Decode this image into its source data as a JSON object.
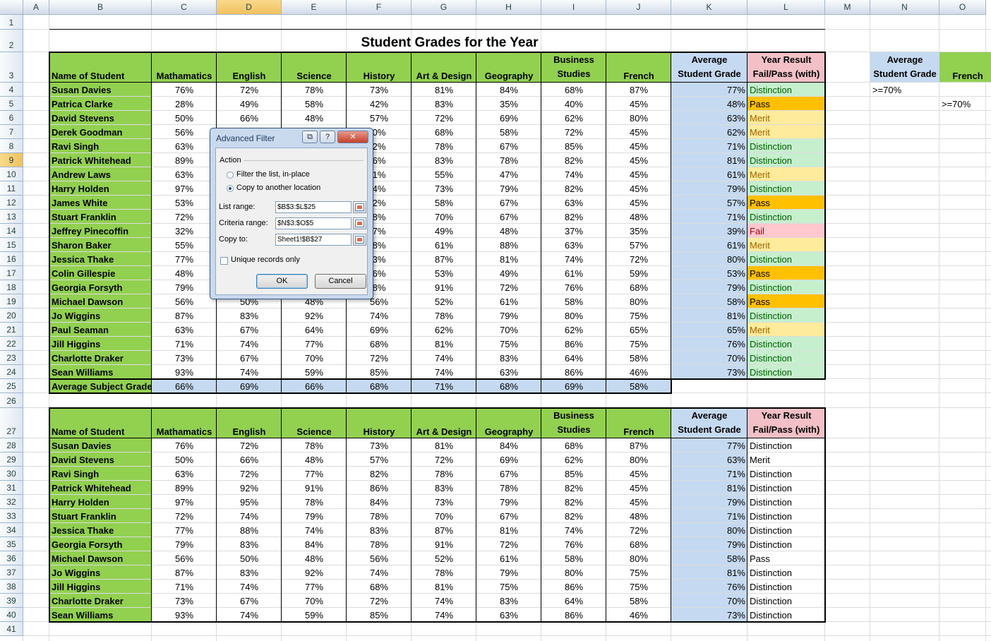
{
  "columns": [
    "A",
    "B",
    "C",
    "D",
    "E",
    "F",
    "G",
    "H",
    "I",
    "J",
    "K",
    "L",
    "M",
    "N",
    "O"
  ],
  "selected_column": "D",
  "selected_row": 9,
  "title": "Student Grades for the Year",
  "header": {
    "name": "Name of Student",
    "subjects": [
      "Mathamatics",
      "English",
      "Science",
      "History",
      "Art & Design",
      "Geography",
      "Business",
      "French"
    ],
    "business_line2": "Studies",
    "avg_line1": "Average",
    "avg_line2": "Student Grade",
    "result_line1": "Year Result",
    "result_line2": "Fail/Pass (with)"
  },
  "main_rows": [
    {
      "name": "Susan Davies",
      "g": [
        "76%",
        "72%",
        "78%",
        "73%",
        "81%",
        "84%",
        "68%",
        "87%"
      ],
      "avg": "77%",
      "result": "Distinction"
    },
    {
      "name": "Patrica Clarke",
      "g": [
        "28%",
        "49%",
        "58%",
        "42%",
        "83%",
        "35%",
        "40%",
        "45%"
      ],
      "avg": "48%",
      "result": "Pass"
    },
    {
      "name": "David Stevens",
      "g": [
        "50%",
        "66%",
        "48%",
        "57%",
        "72%",
        "69%",
        "62%",
        "80%"
      ],
      "avg": "63%",
      "result": "Merit"
    },
    {
      "name": "Derek Goodman",
      "g": [
        "56%",
        "",
        "",
        "0%",
        "68%",
        "58%",
        "72%",
        "45%"
      ],
      "avg": "62%",
      "result": "Merit"
    },
    {
      "name": "Ravi Singh",
      "g": [
        "63%",
        "",
        "",
        "2%",
        "78%",
        "67%",
        "85%",
        "45%"
      ],
      "avg": "71%",
      "result": "Distinction"
    },
    {
      "name": "Patrick Whitehead",
      "g": [
        "89%",
        "",
        "",
        "6%",
        "83%",
        "78%",
        "82%",
        "45%"
      ],
      "avg": "81%",
      "result": "Distinction"
    },
    {
      "name": "Andrew Laws",
      "g": [
        "63%",
        "",
        "",
        "1%",
        "55%",
        "47%",
        "74%",
        "45%"
      ],
      "avg": "61%",
      "result": "Merit"
    },
    {
      "name": "Harry Holden",
      "g": [
        "97%",
        "",
        "",
        "4%",
        "73%",
        "79%",
        "82%",
        "45%"
      ],
      "avg": "79%",
      "result": "Distinction"
    },
    {
      "name": "James White",
      "g": [
        "53%",
        "",
        "",
        "2%",
        "58%",
        "67%",
        "63%",
        "45%"
      ],
      "avg": "57%",
      "result": "Pass"
    },
    {
      "name": "Stuart Franklin",
      "g": [
        "72%",
        "",
        "",
        "8%",
        "70%",
        "67%",
        "82%",
        "48%"
      ],
      "avg": "71%",
      "result": "Distinction"
    },
    {
      "name": "Jeffrey Pinecoffin",
      "g": [
        "32%",
        "",
        "",
        "7%",
        "49%",
        "48%",
        "37%",
        "35%"
      ],
      "avg": "39%",
      "result": "Fail"
    },
    {
      "name": "Sharon Baker",
      "g": [
        "55%",
        "",
        "",
        "8%",
        "61%",
        "88%",
        "63%",
        "57%"
      ],
      "avg": "61%",
      "result": "Merit"
    },
    {
      "name": "Jessica Thake",
      "g": [
        "77%",
        "",
        "",
        "3%",
        "87%",
        "81%",
        "74%",
        "72%"
      ],
      "avg": "80%",
      "result": "Distinction"
    },
    {
      "name": "Colin Gillespie",
      "g": [
        "48%",
        "",
        "",
        "6%",
        "53%",
        "49%",
        "61%",
        "59%"
      ],
      "avg": "53%",
      "result": "Pass"
    },
    {
      "name": "Georgia Forsyth",
      "g": [
        "79%",
        "",
        "",
        "8%",
        "91%",
        "72%",
        "76%",
        "68%"
      ],
      "avg": "79%",
      "result": "Distinction"
    },
    {
      "name": "Michael Dawson",
      "g": [
        "56%",
        "50%",
        "48%",
        "56%",
        "52%",
        "61%",
        "58%",
        "80%"
      ],
      "avg": "58%",
      "result": "Pass"
    },
    {
      "name": "Jo Wiggins",
      "g": [
        "87%",
        "83%",
        "92%",
        "74%",
        "78%",
        "79%",
        "80%",
        "75%"
      ],
      "avg": "81%",
      "result": "Distinction"
    },
    {
      "name": "Paul Seaman",
      "g": [
        "63%",
        "67%",
        "64%",
        "69%",
        "62%",
        "70%",
        "62%",
        "65%"
      ],
      "avg": "65%",
      "result": "Merit"
    },
    {
      "name": "Jill Higgins",
      "g": [
        "71%",
        "74%",
        "77%",
        "68%",
        "81%",
        "75%",
        "86%",
        "75%"
      ],
      "avg": "76%",
      "result": "Distinction"
    },
    {
      "name": "Charlotte Draker",
      "g": [
        "73%",
        "67%",
        "70%",
        "72%",
        "74%",
        "83%",
        "64%",
        "58%"
      ],
      "avg": "70%",
      "result": "Distinction"
    },
    {
      "name": "Sean Williams",
      "g": [
        "93%",
        "74%",
        "59%",
        "85%",
        "74%",
        "63%",
        "86%",
        "46%"
      ],
      "avg": "73%",
      "result": "Distinction"
    }
  ],
  "avg_subject": {
    "label": "Average Subject Grade",
    "g": [
      "66%",
      "69%",
      "66%",
      "68%",
      "71%",
      "68%",
      "69%",
      "58%"
    ]
  },
  "criteria": {
    "h1_line1": "Average",
    "h1_line2": "Student Grade",
    "h2": "French",
    "c1": ">=70%",
    "c2": ">=70%"
  },
  "filtered_rows": [
    {
      "name": "Susan Davies",
      "g": [
        "76%",
        "72%",
        "78%",
        "73%",
        "81%",
        "84%",
        "68%",
        "87%"
      ],
      "avg": "77%",
      "result": "Distinction"
    },
    {
      "name": "David Stevens",
      "g": [
        "50%",
        "66%",
        "48%",
        "57%",
        "72%",
        "69%",
        "62%",
        "80%"
      ],
      "avg": "63%",
      "result": "Merit"
    },
    {
      "name": "Ravi Singh",
      "g": [
        "63%",
        "72%",
        "77%",
        "82%",
        "78%",
        "67%",
        "85%",
        "45%"
      ],
      "avg": "71%",
      "result": "Distinction"
    },
    {
      "name": "Patrick Whitehead",
      "g": [
        "89%",
        "92%",
        "91%",
        "86%",
        "83%",
        "78%",
        "82%",
        "45%"
      ],
      "avg": "81%",
      "result": "Distinction"
    },
    {
      "name": "Harry Holden",
      "g": [
        "97%",
        "95%",
        "78%",
        "84%",
        "73%",
        "79%",
        "82%",
        "45%"
      ],
      "avg": "79%",
      "result": "Distinction"
    },
    {
      "name": "Stuart Franklin",
      "g": [
        "72%",
        "74%",
        "79%",
        "78%",
        "70%",
        "67%",
        "82%",
        "48%"
      ],
      "avg": "71%",
      "result": "Distinction"
    },
    {
      "name": "Jessica Thake",
      "g": [
        "77%",
        "88%",
        "74%",
        "83%",
        "87%",
        "81%",
        "74%",
        "72%"
      ],
      "avg": "80%",
      "result": "Distinction"
    },
    {
      "name": "Georgia Forsyth",
      "g": [
        "79%",
        "83%",
        "84%",
        "78%",
        "91%",
        "72%",
        "76%",
        "68%"
      ],
      "avg": "79%",
      "result": "Distinction"
    },
    {
      "name": "Michael Dawson",
      "g": [
        "56%",
        "50%",
        "48%",
        "56%",
        "52%",
        "61%",
        "58%",
        "80%"
      ],
      "avg": "58%",
      "result": "Pass"
    },
    {
      "name": "Jo Wiggins",
      "g": [
        "87%",
        "83%",
        "92%",
        "74%",
        "78%",
        "79%",
        "80%",
        "75%"
      ],
      "avg": "81%",
      "result": "Distinction"
    },
    {
      "name": "Jill Higgins",
      "g": [
        "71%",
        "74%",
        "77%",
        "68%",
        "81%",
        "75%",
        "86%",
        "75%"
      ],
      "avg": "76%",
      "result": "Distinction"
    },
    {
      "name": "Charlotte Draker",
      "g": [
        "73%",
        "67%",
        "70%",
        "72%",
        "74%",
        "83%",
        "64%",
        "58%"
      ],
      "avg": "70%",
      "result": "Distinction"
    },
    {
      "name": "Sean Williams",
      "g": [
        "93%",
        "74%",
        "59%",
        "85%",
        "74%",
        "63%",
        "86%",
        "46%"
      ],
      "avg": "73%",
      "result": "Distinction"
    }
  ],
  "dialog": {
    "title": "Advanced Filter",
    "help": "?",
    "close": "✕",
    "action_label": "Action",
    "radio1": "Filter the list, in-place",
    "radio2": "Copy to another location",
    "list_range_label": "List range:",
    "list_range": "$B$3:$L$25",
    "criteria_label": "Criteria range:",
    "criteria_range": "$N$3:$O$5",
    "copy_to_label": "Copy to:",
    "copy_to": "Sheet1!$B$27",
    "unique_label": "Unique records only",
    "ok": "OK",
    "cancel": "Cancel"
  },
  "colors": {
    "green": "#92d050",
    "blue": "#c5d9f1",
    "pink": "#f2c0c6",
    "distinction": "#c6efce",
    "pass": "#ffc000",
    "merit": "#ffeb9c",
    "fail": "#ffc7ce"
  }
}
